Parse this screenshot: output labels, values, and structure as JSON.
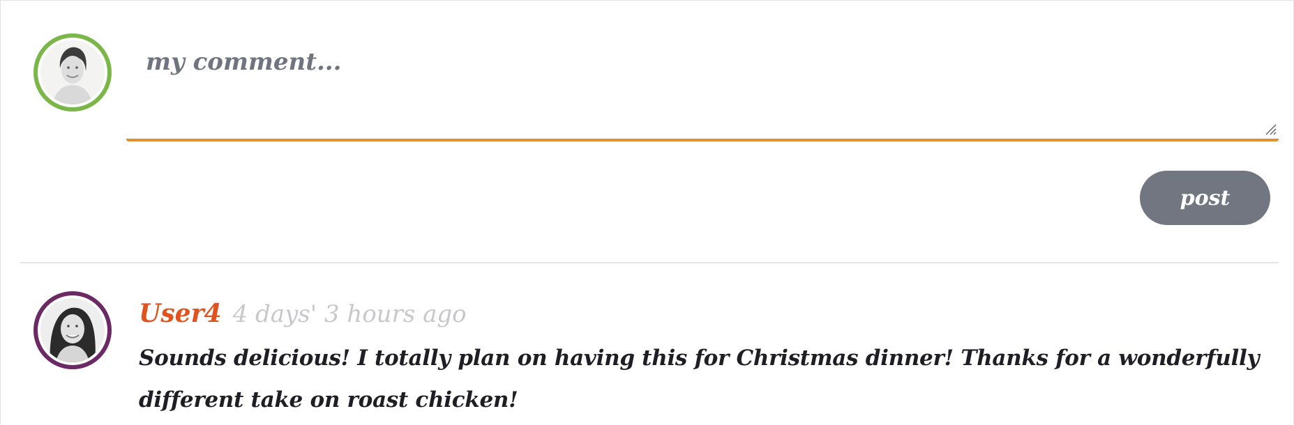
{
  "composer": {
    "avatar_icon": "user-avatar-photo",
    "avatar_ring_color": "#7ab648",
    "placeholder": "my comment...",
    "value": "",
    "underline_color": "#e58f33",
    "post_label": "post",
    "post_button_color": "#727681"
  },
  "comments": [
    {
      "avatar_icon": "user-avatar-photo",
      "avatar_ring_color": "#6b2a63",
      "username": "User4",
      "username_color": "#e0531f",
      "timestamp": "4 days' 3 hours ago",
      "text": "Sounds delicious! I totally plan on having this for Christmas dinner! Thanks for a wonderfully different take on roast chicken!"
    }
  ]
}
